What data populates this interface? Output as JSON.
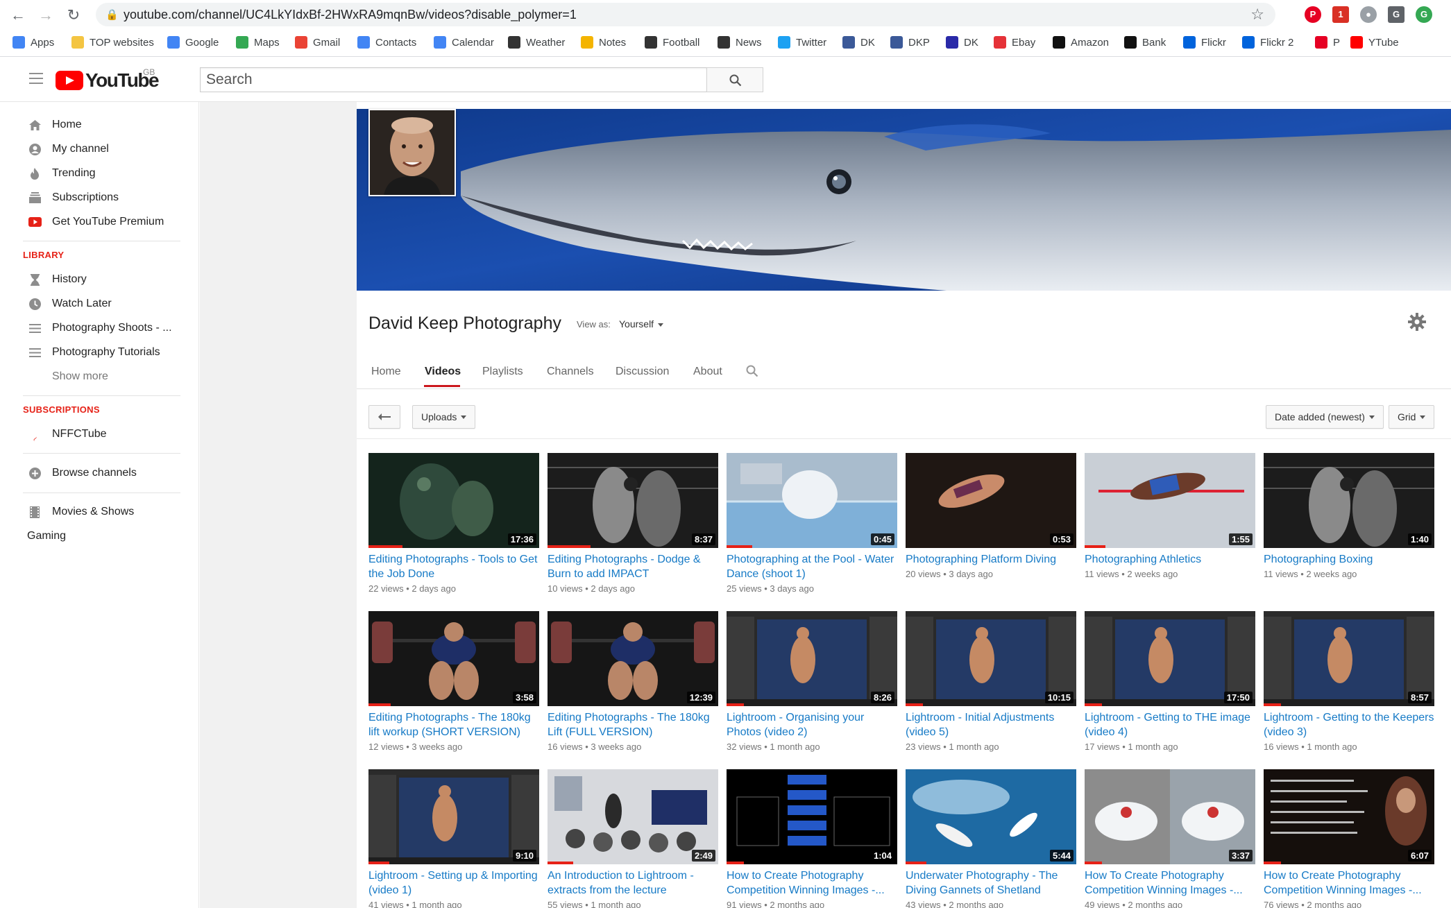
{
  "browser": {
    "url": "youtube.com/channel/UC4LkYIdxBf-2HWxRA9mqnBw/videos?disable_polymer=1",
    "bookmarks": [
      {
        "label": "Apps",
        "icon": "apps-grid-icon",
        "color": "#4285f4"
      },
      {
        "label": "TOP websites",
        "icon": "folder-icon",
        "color": "#f4c542"
      },
      {
        "label": "Google",
        "icon": "google-icon",
        "color": "#4285f4"
      },
      {
        "label": "Maps",
        "icon": "maps-icon",
        "color": "#34a853"
      },
      {
        "label": "Gmail",
        "icon": "gmail-icon",
        "color": "#ea4335"
      },
      {
        "label": "Contacts",
        "icon": "contacts-icon",
        "color": "#4285f4"
      },
      {
        "label": "Calendar",
        "icon": "calendar-icon",
        "color": "#4285f4"
      },
      {
        "label": "Weather",
        "icon": "bbc-icon",
        "color": "#333333"
      },
      {
        "label": "Notes",
        "icon": "notes-icon",
        "color": "#f4b400"
      },
      {
        "label": "Football",
        "icon": "bbc-icon",
        "color": "#333333"
      },
      {
        "label": "News",
        "icon": "bbc-icon",
        "color": "#333333"
      },
      {
        "label": "Twitter",
        "icon": "twitter-icon",
        "color": "#1da1f2"
      },
      {
        "label": "DK",
        "icon": "facebook-icon",
        "color": "#3b5998"
      },
      {
        "label": "DKP",
        "icon": "facebook-icon",
        "color": "#3b5998"
      },
      {
        "label": "DK",
        "icon": "dk-icon",
        "color": "#2a2aa8"
      },
      {
        "label": "Ebay",
        "icon": "ebay-icon",
        "color": "#e53238"
      },
      {
        "label": "Amazon",
        "icon": "amazon-icon",
        "color": "#111111"
      },
      {
        "label": "Bank",
        "icon": "bank-icon",
        "color": "#111111"
      },
      {
        "label": "Flickr",
        "icon": "flickr-icon",
        "color": "#0063dc"
      },
      {
        "label": "Flickr 2",
        "icon": "flickr-icon",
        "color": "#0063dc"
      },
      {
        "label": "P",
        "icon": "pinterest-icon",
        "color": "#e60023"
      },
      {
        "label": "YTube",
        "icon": "youtube-icon",
        "color": "#ff0000"
      }
    ]
  },
  "masthead": {
    "logo_text": "YouTube",
    "region": "GB",
    "search_placeholder": "Search"
  },
  "guide": {
    "main": [
      {
        "label": "Home",
        "icon": "home-icon"
      },
      {
        "label": "My channel",
        "icon": "account-icon"
      },
      {
        "label": "Trending",
        "icon": "flame-icon"
      },
      {
        "label": "Subscriptions",
        "icon": "subscriptions-icon"
      },
      {
        "label": "Get YouTube Premium",
        "icon": "youtube-premium-icon"
      }
    ],
    "library_heading": "LIBRARY",
    "library": [
      {
        "label": "History",
        "icon": "hourglass-icon"
      },
      {
        "label": "Watch Later",
        "icon": "clock-icon"
      },
      {
        "label": "Photography Shoots - ...",
        "icon": "playlist-icon"
      },
      {
        "label": "Photography Tutorials",
        "icon": "playlist-icon"
      }
    ],
    "show_more": "Show more",
    "subscriptions_heading": "SUBSCRIPTIONS",
    "subscriptions": [
      {
        "label": "NFFCTube",
        "icon": "nffc-crest-icon"
      }
    ],
    "browse_channels": "Browse channels",
    "movies_shows": "Movies & Shows",
    "gaming": "Gaming"
  },
  "channel": {
    "title": "David Keep Photography",
    "view_as_label": "View as:",
    "view_as_value": "Yourself",
    "tabs": [
      "Home",
      "Videos",
      "Playlists",
      "Channels",
      "Discussion",
      "About"
    ],
    "active_tab": "Videos"
  },
  "toolbar": {
    "uploads": "Uploads",
    "sort": "Date added (newest)",
    "layout": "Grid"
  },
  "videos": [
    {
      "title": "Editing Photographs - Tools to Get the Job Done",
      "views": "22 views",
      "age": "2 days ago",
      "duration": "17:36",
      "thumb": "dark-green",
      "progress": 0.2
    },
    {
      "title": "Editing Photographs - Dodge & Burn to add IMPACT",
      "views": "10 views",
      "age": "2 days ago",
      "duration": "8:37",
      "thumb": "boxing-bw",
      "progress": 0.25
    },
    {
      "title": "Photographing at the Pool - Water Dance (shoot 1)",
      "views": "25 views",
      "age": "3 days ago",
      "duration": "0:45",
      "thumb": "pool",
      "progress": 0.15
    },
    {
      "title": "Photographing Platform Diving",
      "views": "20 views",
      "age": "3 days ago",
      "duration": "0:53",
      "thumb": "diving",
      "progress": 0
    },
    {
      "title": "Photographing Athletics",
      "views": "11 views",
      "age": "2 weeks ago",
      "duration": "1:55",
      "thumb": "athletics",
      "progress": 0.12
    },
    {
      "title": "Photographing Boxing",
      "views": "11 views",
      "age": "2 weeks ago",
      "duration": "1:40",
      "thumb": "boxing-bw",
      "progress": 0
    },
    {
      "title": "Editing Photographs - The 180kg lift workup (SHORT VERSION)",
      "views": "12 views",
      "age": "3 weeks ago",
      "duration": "3:58",
      "thumb": "lift",
      "progress": 0.13
    },
    {
      "title": "Editing Photographs - The 180kg Lift (FULL VERSION)",
      "views": "16 views",
      "age": "3 weeks ago",
      "duration": "12:39",
      "thumb": "lift",
      "progress": 0
    },
    {
      "title": "Lightroom - Organising your Photos (video 2)",
      "views": "32 views",
      "age": "1 month ago",
      "duration": "8:26",
      "thumb": "lightroom",
      "progress": 0.1
    },
    {
      "title": "Lightroom - Initial Adjustments (video 5)",
      "views": "23 views",
      "age": "1 month ago",
      "duration": "10:15",
      "thumb": "lightroom",
      "progress": 0.1
    },
    {
      "title": "Lightroom - Getting to THE image (video 4)",
      "views": "17 views",
      "age": "1 month ago",
      "duration": "17:50",
      "thumb": "lightroom",
      "progress": 0.1
    },
    {
      "title": "Lightroom - Getting to the Keepers (video 3)",
      "views": "16 views",
      "age": "1 month ago",
      "duration": "8:57",
      "thumb": "lightroom",
      "progress": 0.1
    },
    {
      "title": "Lightroom - Setting up & Importing (video 1)",
      "views": "41 views",
      "age": "1 month ago",
      "duration": "9:10",
      "thumb": "lightroom",
      "progress": 0.12
    },
    {
      "title": "An Introduction to Lightroom - extracts from the lecture",
      "views": "55 views",
      "age": "1 month ago",
      "duration": "2:49",
      "thumb": "lecture",
      "progress": 0.15
    },
    {
      "title": "How to Create Photography Competition Winning Images -...",
      "views": "91 views",
      "age": "2 months ago",
      "duration": "1:04",
      "thumb": "diagram",
      "progress": 0.1
    },
    {
      "title": "Underwater Photography - The Diving Gannets of Shetland",
      "views": "43 views",
      "age": "2 months ago",
      "duration": "5:44",
      "thumb": "underwater",
      "progress": 0.12
    },
    {
      "title": "How To Create Photography Competition Winning Images -...",
      "views": "49 views",
      "age": "2 months ago",
      "duration": "3:37",
      "thumb": "kayak",
      "progress": 0.1
    },
    {
      "title": "How to Create Photography Competition Winning Images -...",
      "views": "76 views",
      "age": "2 months ago",
      "duration": "6:07",
      "thumb": "text-dark",
      "progress": 0.1
    }
  ]
}
